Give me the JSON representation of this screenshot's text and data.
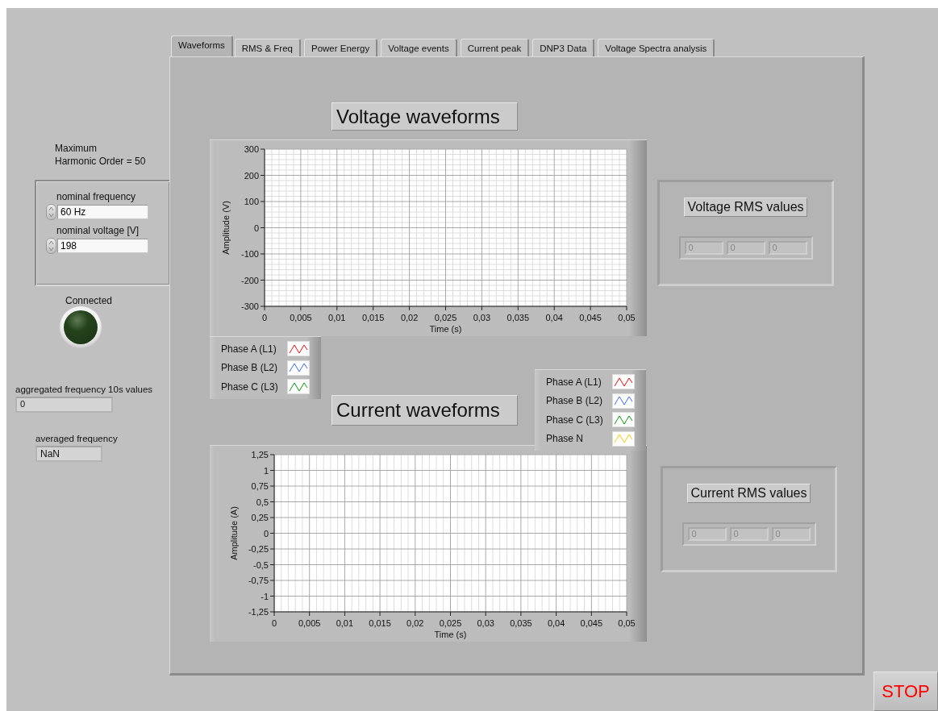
{
  "tabs": [
    {
      "label": "Waveforms",
      "selected": true
    },
    {
      "label": "RMS & Freq",
      "selected": false
    },
    {
      "label": "Power Energy",
      "selected": false
    },
    {
      "label": "Voltage events",
      "selected": false
    },
    {
      "label": "Current peak",
      "selected": false
    },
    {
      "label": "DNP3 Data",
      "selected": false
    },
    {
      "label": "Voltage Spectra analysis",
      "selected": false
    }
  ],
  "harmonic_label": [
    "Maximum",
    "Harmonic Order = 50"
  ],
  "settings": [
    {
      "label": "nominal frequency",
      "value": "60 Hz"
    },
    {
      "label": "nominal voltage [V]",
      "value": "198"
    }
  ],
  "connection": {
    "label": "Connected",
    "on": false
  },
  "indicators": [
    {
      "label": "aggregated frequency 10s values",
      "value": "0"
    },
    {
      "label": "averaged frequency",
      "value": "NaN"
    }
  ],
  "voltage_section": {
    "title": "Voltage waveforms",
    "chart_data": {
      "type": "line",
      "grid": true,
      "xlabel": "Time (s)",
      "ylabel": "Amplitude (V)",
      "xlim": [
        0,
        0.05
      ],
      "ylim": [
        -300,
        300
      ],
      "xticks": [
        0,
        {
          "value": 0.005,
          "label": "0,005"
        },
        {
          "value": 0.01,
          "label": "0,01"
        },
        {
          "value": 0.015,
          "label": "0,015"
        },
        {
          "value": 0.02,
          "label": "0,02"
        },
        {
          "value": 0.025,
          "label": "0,025"
        },
        {
          "value": 0.03,
          "label": "0,03"
        },
        {
          "value": 0.035,
          "label": "0,035"
        },
        {
          "value": 0.04,
          "label": "0,04"
        },
        {
          "value": 0.045,
          "label": "0,045"
        },
        {
          "value": 0.05,
          "label": "0,05"
        }
      ],
      "yticks": [
        300,
        200,
        100,
        0,
        -100,
        -200,
        -300
      ]
    },
    "legend": [
      {
        "name": "Phase A (L1)",
        "color": "#ff0000"
      },
      {
        "name": "Phase B (L2)",
        "color": "#3366ff"
      },
      {
        "name": "Phase C (L3)",
        "color": "#009900"
      }
    ],
    "rms": {
      "title": "Voltage RMS values",
      "values": [
        "0",
        "0",
        "0"
      ]
    }
  },
  "current_section": {
    "title": "Current waveforms",
    "chart_data": {
      "type": "line",
      "grid": true,
      "xlabel": "Time (s)",
      "ylabel": "Amplitude (A)",
      "xlim": [
        0,
        0.05
      ],
      "ylim": [
        -1.25,
        1.25
      ],
      "xticks": [
        0,
        {
          "value": 0.005,
          "label": "0,005"
        },
        {
          "value": 0.01,
          "label": "0,01"
        },
        {
          "value": 0.015,
          "label": "0,015"
        },
        {
          "value": 0.02,
          "label": "0,02"
        },
        {
          "value": 0.025,
          "label": "0,025"
        },
        {
          "value": 0.03,
          "label": "0,03"
        },
        {
          "value": 0.035,
          "label": "0,035"
        },
        {
          "value": 0.04,
          "label": "0,04"
        },
        {
          "value": 0.045,
          "label": "0,045"
        },
        {
          "value": 0.05,
          "label": "0,05"
        }
      ],
      "yticks": [
        {
          "value": 1.25,
          "label": "1,25"
        },
        1,
        {
          "value": 0.75,
          "label": "0,75"
        },
        {
          "value": 0.5,
          "label": "0,5"
        },
        {
          "value": 0.25,
          "label": "0,25"
        },
        0,
        {
          "value": -0.25,
          "label": "-0,25"
        },
        {
          "value": -0.5,
          "label": "-0,5"
        },
        {
          "value": -0.75,
          "label": "-0,75"
        },
        -1,
        {
          "value": -1.25,
          "label": "-1,25"
        }
      ]
    },
    "legend": [
      {
        "name": "Phase A (L1)",
        "color": "#ff0000"
      },
      {
        "name": "Phase B (L2)",
        "color": "#3366ff"
      },
      {
        "name": "Phase C (L3)",
        "color": "#009900"
      },
      {
        "name": "Phase N",
        "color": "#ffcc00"
      }
    ],
    "rms": {
      "title": "Current RMS values",
      "values": [
        "0",
        "0",
        "0"
      ]
    }
  },
  "stop_button": {
    "label": "STOP"
  }
}
